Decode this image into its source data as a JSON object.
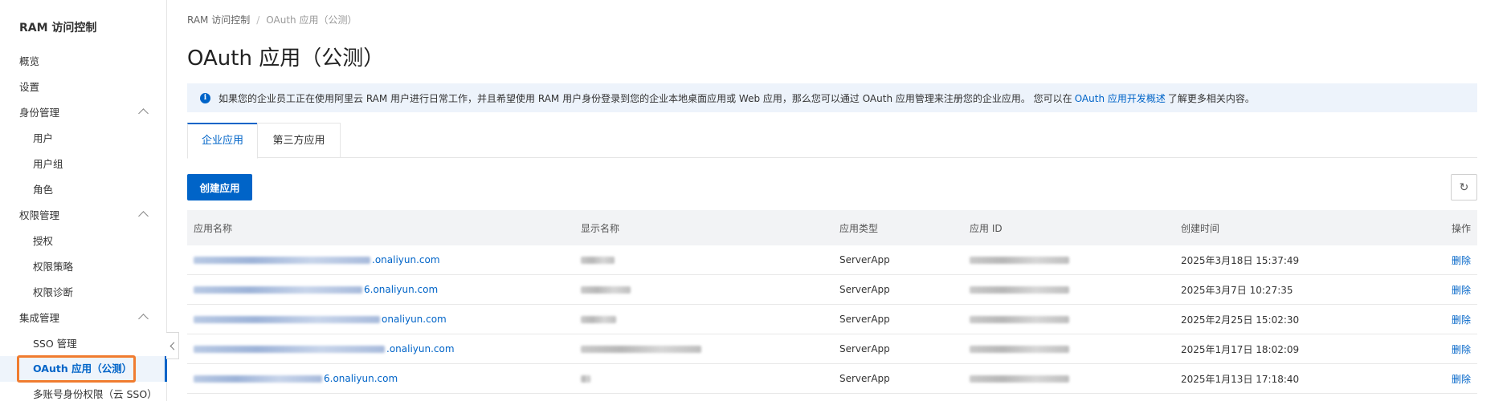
{
  "sidebar": {
    "title": "RAM 访问控制",
    "items": [
      {
        "label": "概览",
        "type": "top"
      },
      {
        "label": "设置",
        "type": "top"
      },
      {
        "label": "身份管理",
        "type": "group"
      },
      {
        "label": "用户",
        "type": "sub"
      },
      {
        "label": "用户组",
        "type": "sub"
      },
      {
        "label": "角色",
        "type": "sub"
      },
      {
        "label": "权限管理",
        "type": "group"
      },
      {
        "label": "授权",
        "type": "sub"
      },
      {
        "label": "权限策略",
        "type": "sub"
      },
      {
        "label": "权限诊断",
        "type": "sub"
      },
      {
        "label": "集成管理",
        "type": "group"
      },
      {
        "label": "SSO 管理",
        "type": "sub"
      },
      {
        "label": "OAuth 应用（公测）",
        "type": "sub",
        "active": true
      },
      {
        "label": "多账号身份权限（云 SSO）",
        "type": "sub"
      }
    ]
  },
  "breadcrumb": {
    "root": "RAM 访问控制",
    "sep": "/",
    "current": "OAuth 应用（公测）"
  },
  "page_title": "OAuth 应用（公测）",
  "notice": {
    "text_before": "如果您的企业员工正在使用阿里云 RAM 用户进行日常工作，并且希望使用 RAM 用户身份登录到您的企业本地桌面应用或 Web 应用，那么您可以通过 OAuth 应用管理来注册您的企业应用。 您可以在",
    "link": "OAuth 应用开发概述",
    "text_after": "了解更多相关内容。"
  },
  "tabs": [
    {
      "label": "企业应用",
      "active": true
    },
    {
      "label": "第三方应用",
      "active": false
    }
  ],
  "create_button": "创建应用",
  "refresh_icon": "↻",
  "table": {
    "columns": [
      "应用名称",
      "显示名称",
      "应用类型",
      "应用 ID",
      "创建时间",
      "操作"
    ],
    "rows": [
      {
        "name_suffix": ".onaliyun.com",
        "type": "ServerApp",
        "created": "2025年3月18日 15:37:49",
        "action": "删除"
      },
      {
        "name_suffix": "6.onaliyun.com",
        "type": "ServerApp",
        "created": "2025年3月7日 10:27:35",
        "action": "删除"
      },
      {
        "name_suffix": "onaliyun.com",
        "type": "ServerApp",
        "created": "2025年2月25日 15:02:30",
        "action": "删除"
      },
      {
        "name_suffix": ".onaliyun.com",
        "type": "ServerApp",
        "created": "2025年1月17日 18:02:09",
        "action": "删除"
      },
      {
        "name_suffix": "6.onaliyun.com",
        "type": "ServerApp",
        "created": "2025年1月13日 17:18:40",
        "action": "删除"
      }
    ]
  }
}
